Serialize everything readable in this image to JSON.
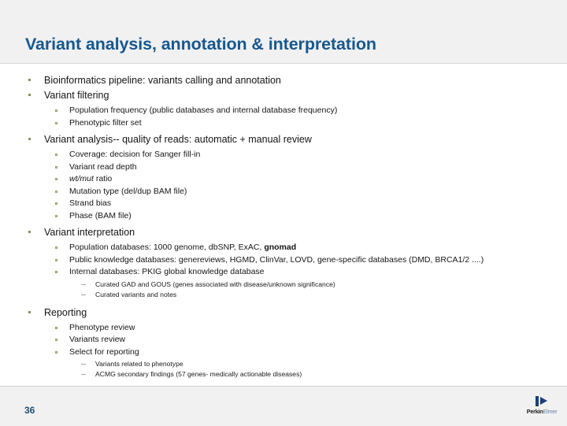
{
  "slide": {
    "title": "Variant analysis, annotation & interpretation",
    "page_number": "36",
    "accent_color": "#17588f",
    "bullet_color": "#8b8f5b",
    "header_bg": "#f1f1f1",
    "body_bg": "#ffffff"
  },
  "content": {
    "item1": "Bioinformatics pipeline: variants calling and annotation",
    "item2": "Variant filtering",
    "item2_sub": [
      "Population frequency (public databases and internal database frequency)",
      "Phenotypic filter set"
    ],
    "item3": "Variant analysis-- quality of reads: automatic + manual review",
    "item3_sub": [
      "Coverage: decision for Sanger fill-in",
      "Variant read depth",
      "Mutation type (del/dup BAM file)",
      "Strand bias",
      "Phase (BAM file)"
    ],
    "item3_sub_ratio_italic": "wt/mut",
    "item3_sub_ratio_rest": " ratio",
    "item4": "Variant interpretation",
    "item4_sub1_pre": "Population databases: 1000 genome, dbSNP, ExAC, ",
    "item4_sub1_bold": "gnomad",
    "item4_sub2": "Public knowledge databases: genereviews, HGMD, ClinVar, LOVD, gene-specific databases (DMD, BRCA1/2 ....)",
    "item4_sub3": "Internal databases: PKIG global knowledge database",
    "item4_sub3_dashes": [
      "Curated GAD and GOUS (genes associated with disease/unknown significance)",
      "Curated variants and notes"
    ],
    "item5": "Reporting",
    "item5_sub": [
      "Phenotype review",
      "Variants review",
      "Select for reporting"
    ],
    "item5_sub3_dashes": [
      "Variants related to phenotype",
      "ACMG secondary findings (57 genes- medically actionable diseases)"
    ]
  },
  "logo": {
    "name_part1": "Perkin",
    "name_part2": "Elmer"
  }
}
